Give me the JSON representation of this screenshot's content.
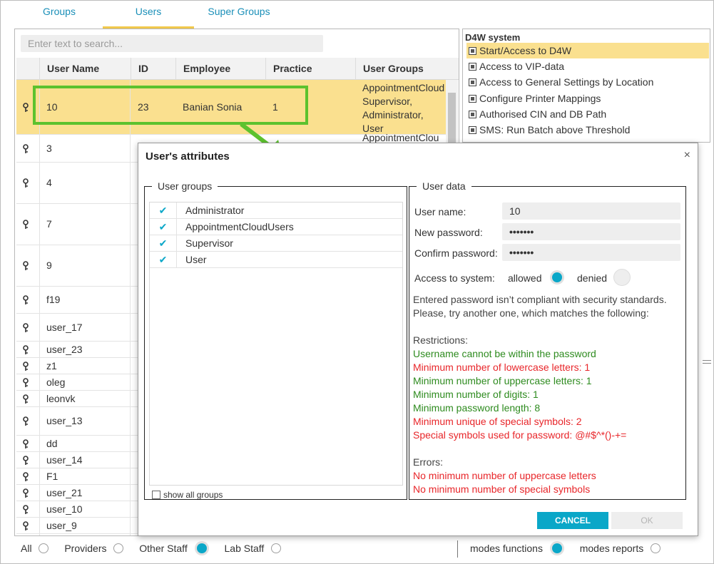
{
  "tabs": [
    {
      "label": "Groups"
    },
    {
      "label": "Users"
    },
    {
      "label": "Super Groups"
    }
  ],
  "search": {
    "placeholder": "Enter text to search..."
  },
  "grid": {
    "columns": [
      "User Name",
      "ID",
      "Employee",
      "Practice",
      "User Groups"
    ],
    "rows": [
      {
        "user": "10",
        "id": "23",
        "employee": "Banian Sonia",
        "practice": "1",
        "groups": [
          "AppointmentCloud",
          "Supervisor,",
          "Administrator,",
          "User"
        ]
      },
      {
        "user": "3",
        "groups_peek": "AppointmentClou"
      },
      {
        "user": "4"
      },
      {
        "user": "7"
      },
      {
        "user": "9"
      },
      {
        "user": "f19"
      },
      {
        "user": "user_17"
      },
      {
        "user": "user_23"
      },
      {
        "user": "z1"
      },
      {
        "user": "oleg"
      },
      {
        "user": "leonvk"
      },
      {
        "user": "user_13"
      },
      {
        "user": "dd"
      },
      {
        "user": "user_14"
      },
      {
        "user": "F1"
      },
      {
        "user": "user_21"
      },
      {
        "user": "user_10"
      },
      {
        "user": "user_9"
      }
    ]
  },
  "permissions": {
    "title": "D4W system",
    "items": [
      "Start/Access to D4W",
      "Access to VIP-data",
      "Access to General Settings by Location",
      "Configure Printer Mappings",
      "Authorised CIN and DB Path",
      "SMS: Run Batch above Threshold"
    ]
  },
  "filters": {
    "all": "All",
    "providers": "Providers",
    "other_staff": "Other Staff",
    "lab_staff": "Lab Staff",
    "selected": "Other Staff"
  },
  "modes": {
    "functions": "modes functions",
    "reports": "modes reports",
    "selected": "modes functions"
  },
  "dialog": {
    "title": "User's attributes",
    "close": "×",
    "user_groups": {
      "legend": "User groups",
      "items": [
        {
          "label": "Administrator",
          "checked": true
        },
        {
          "label": "AppointmentCloudUsers",
          "checked": true
        },
        {
          "label": "Supervisor",
          "checked": true
        },
        {
          "label": "User",
          "checked": true
        }
      ],
      "show_all": "show all groups"
    },
    "user_data": {
      "legend": "User data",
      "username_label": "User name:",
      "username_value": "10",
      "new_password_label": "New password:",
      "new_password_value": "•••••••",
      "confirm_password_label": "Confirm password:",
      "confirm_password_value": "•••••••",
      "access_label": "Access to system:",
      "allowed": "allowed",
      "denied": "denied",
      "access_selected": "allowed",
      "message_line1": "Entered password isn’t compliant with security standards.",
      "message_line2": "Please, try another one, which matches the following:",
      "restrictions_title": "Restrictions:",
      "restrictions": [
        {
          "text": "Username cannot be within the password",
          "status": "ok"
        },
        {
          "text": "Minimum number of lowercase letters: 1",
          "status": "fail"
        },
        {
          "text": "Minimum number of uppercase letters: 1",
          "status": "ok"
        },
        {
          "text": "Minimum number of digits: 1",
          "status": "ok"
        },
        {
          "text": "Minimum password length: 8",
          "status": "ok"
        },
        {
          "text": "Minimum unique of special symbols: 2",
          "status": "fail"
        },
        {
          "text": "Special symbols used for password: @#$^*()-+=",
          "status": "fail"
        }
      ],
      "errors_title": "Errors:",
      "errors": [
        "No minimum number of uppercase letters",
        "No minimum number of special symbols"
      ]
    },
    "cancel": "CANCEL",
    "ok": "OK"
  },
  "colors": {
    "accent": "#0aa7c8",
    "selection": "#fae08f",
    "highlight": "#5cc22e",
    "ok_text": "#2e8b1f",
    "error_text": "#e8262a"
  }
}
